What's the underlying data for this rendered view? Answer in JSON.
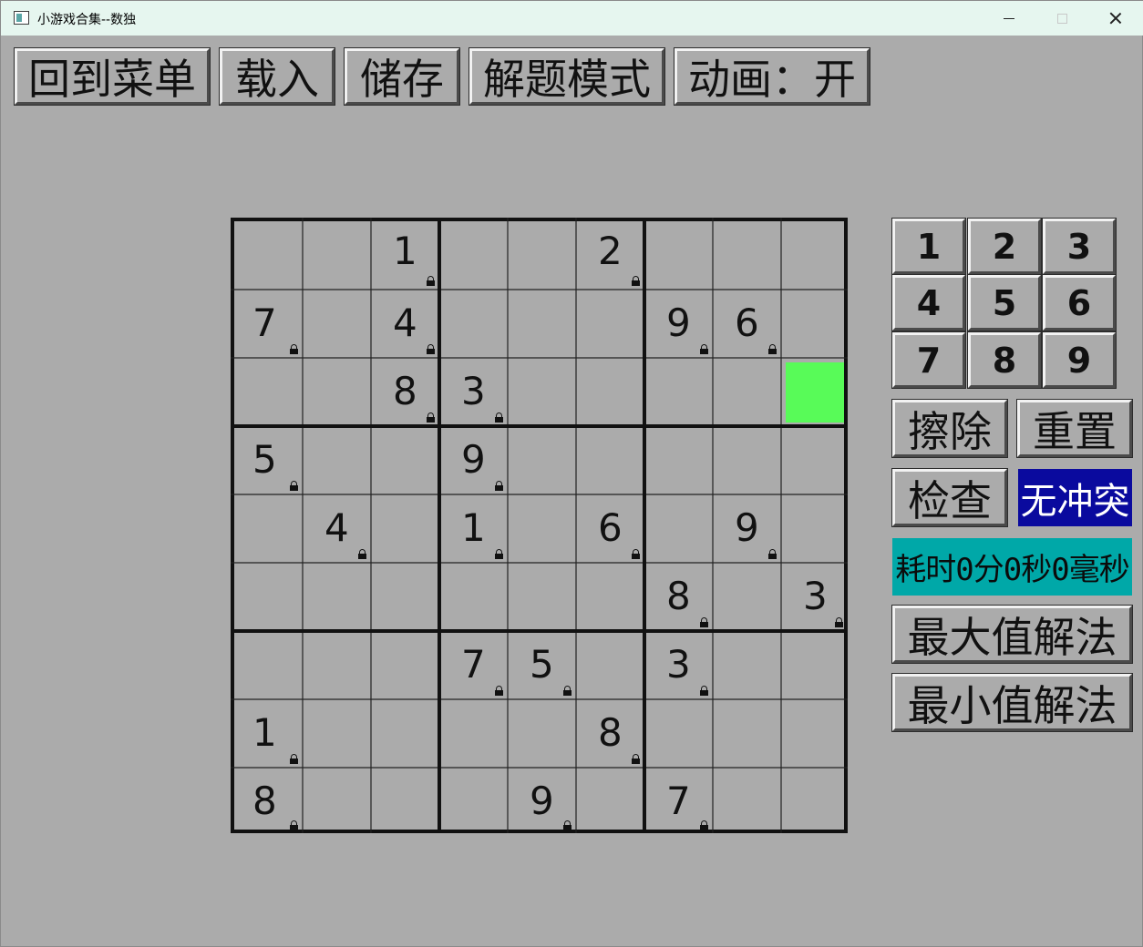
{
  "window": {
    "title": "小游戏合集--数独"
  },
  "toolbar": {
    "menu_label": "回到菜单",
    "load_label": "载入",
    "save_label": "储存",
    "solve_mode_label": "解题模式",
    "animation_label": "动画：开"
  },
  "board": {
    "selected": {
      "row": 2,
      "col": 8
    },
    "selected_color": "#58fb58",
    "rows": [
      [
        "",
        "",
        "1",
        "",
        "",
        "2",
        "",
        "",
        ""
      ],
      [
        "7",
        "",
        "4",
        "",
        "",
        "",
        "9",
        "6",
        ""
      ],
      [
        "",
        "",
        "8",
        "3",
        "",
        "",
        "",
        "",
        ""
      ],
      [
        "5",
        "",
        "",
        "9",
        "",
        "",
        "",
        "",
        ""
      ],
      [
        "",
        "4",
        "",
        "1",
        "",
        "6",
        "",
        "9",
        ""
      ],
      [
        "",
        "",
        "",
        "",
        "",
        "",
        "8",
        "",
        "3"
      ],
      [
        "",
        "",
        "",
        "7",
        "5",
        "",
        "3",
        "",
        ""
      ],
      [
        "1",
        "",
        "",
        "",
        "",
        "8",
        "",
        "",
        ""
      ],
      [
        "8",
        "",
        "",
        "",
        "9",
        "",
        "7",
        "",
        ""
      ]
    ]
  },
  "numpad": {
    "keys": [
      "1",
      "2",
      "3",
      "4",
      "5",
      "6",
      "7",
      "8",
      "9"
    ]
  },
  "controls": {
    "erase_label": "擦除",
    "reset_label": "重置",
    "check_label": "检查",
    "status_text": "无冲突",
    "status_color": "#0a0a9e",
    "timer_text": "耗时0分0秒0毫秒",
    "timer_color": "#00a8a8",
    "max_solve_label": "最大值解法",
    "min_solve_label": "最小值解法"
  }
}
